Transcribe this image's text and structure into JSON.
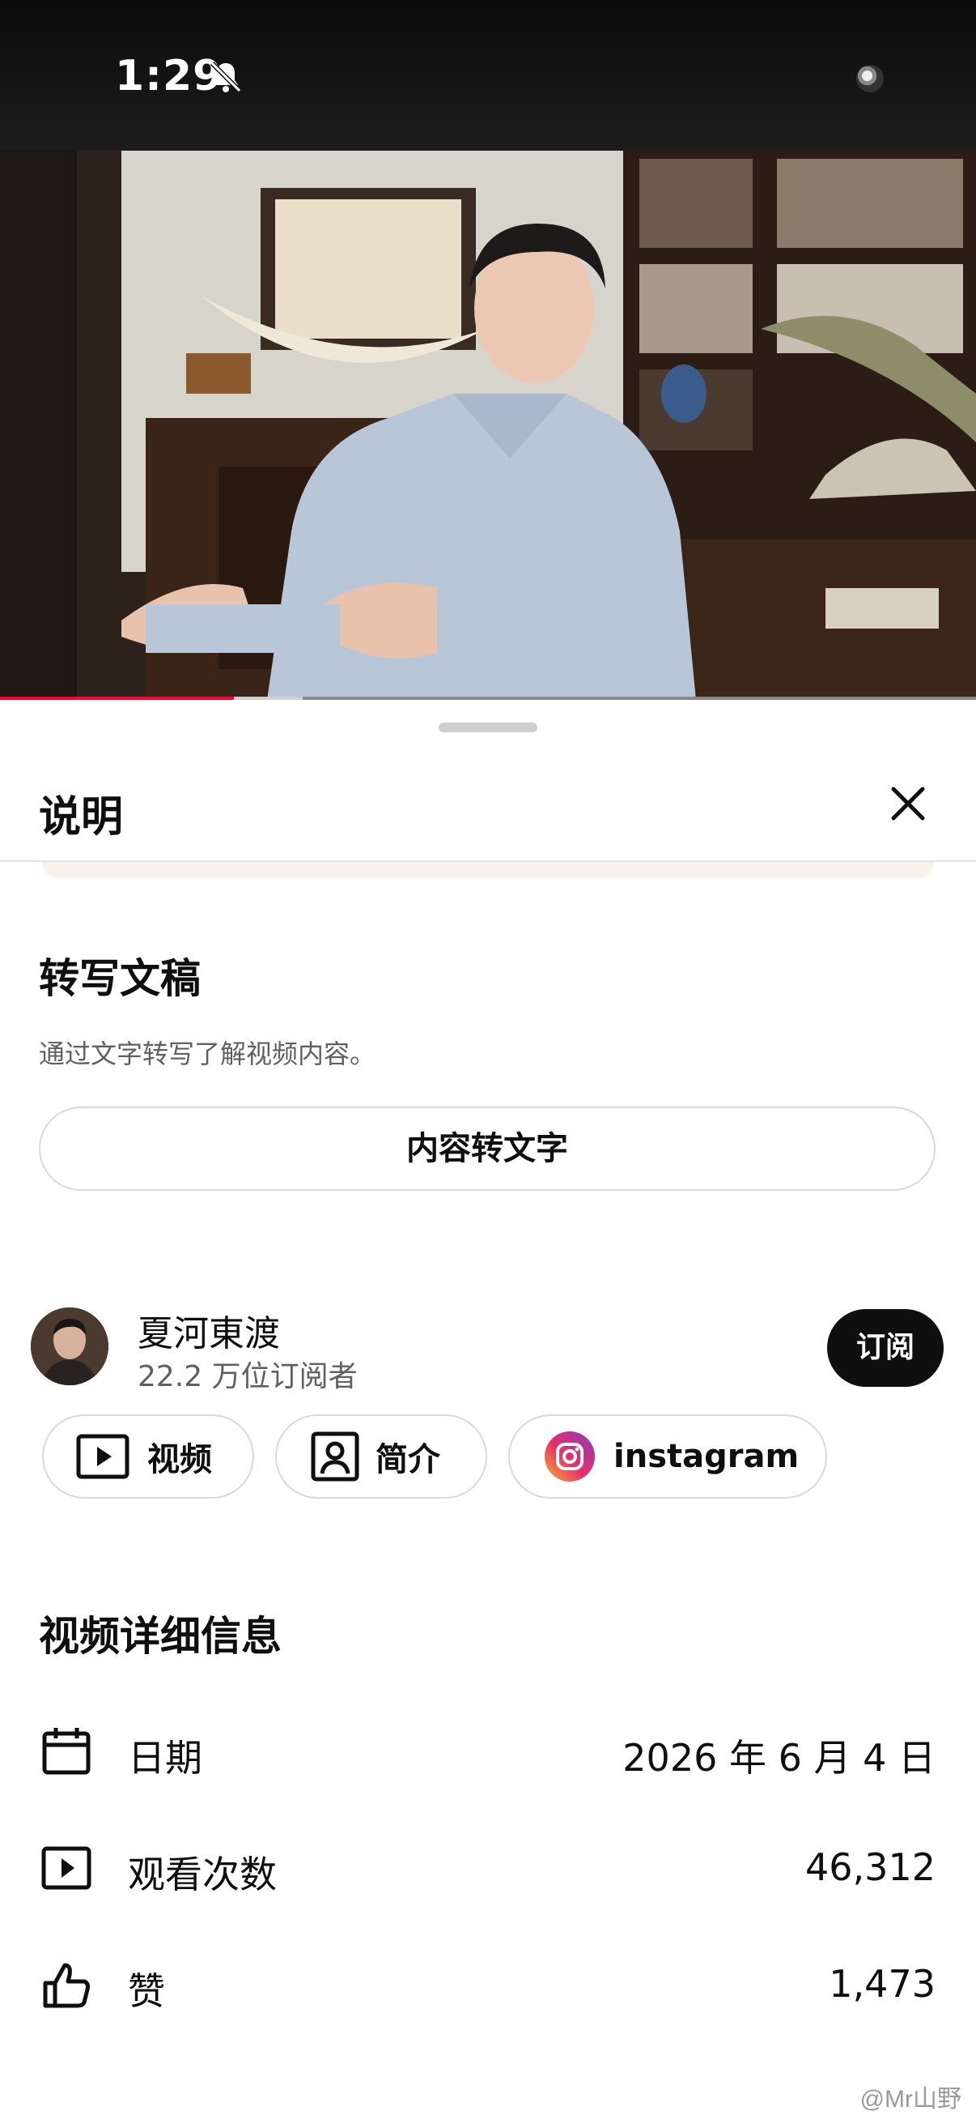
{
  "status_bar": {
    "time": "1:29"
  },
  "video": {
    "progress": 0.24,
    "buffered": 0.31
  },
  "sheet": {
    "title": "说明",
    "transcript": {
      "title": "转写文稿",
      "description": "通过文字转写了解视频内容。",
      "button_label": "内容转文字"
    },
    "channel": {
      "name": "夏河東渡",
      "subscribers": "22.2 万位订阅者",
      "subscribe_label": "订阅"
    },
    "chips": [
      {
        "label": "视频",
        "icon": "play-box-icon"
      },
      {
        "label": "简介",
        "icon": "profile-box-icon"
      },
      {
        "label": "instagram",
        "icon": "instagram-icon"
      }
    ],
    "details": {
      "title": "视频详细信息",
      "rows": [
        {
          "label": "日期",
          "value": "2026 年 6 月 4 日",
          "icon": "calendar-icon"
        },
        {
          "label": "观看次数",
          "value": "46,312",
          "icon": "play-box-icon"
        },
        {
          "label": "赞",
          "value": "1,473",
          "icon": "thumbs-up-icon"
        }
      ]
    }
  },
  "watermark": "@Mr山野",
  "colors": {
    "progress": "#ff0033",
    "subscribe_bg": "#0f0f0f"
  }
}
